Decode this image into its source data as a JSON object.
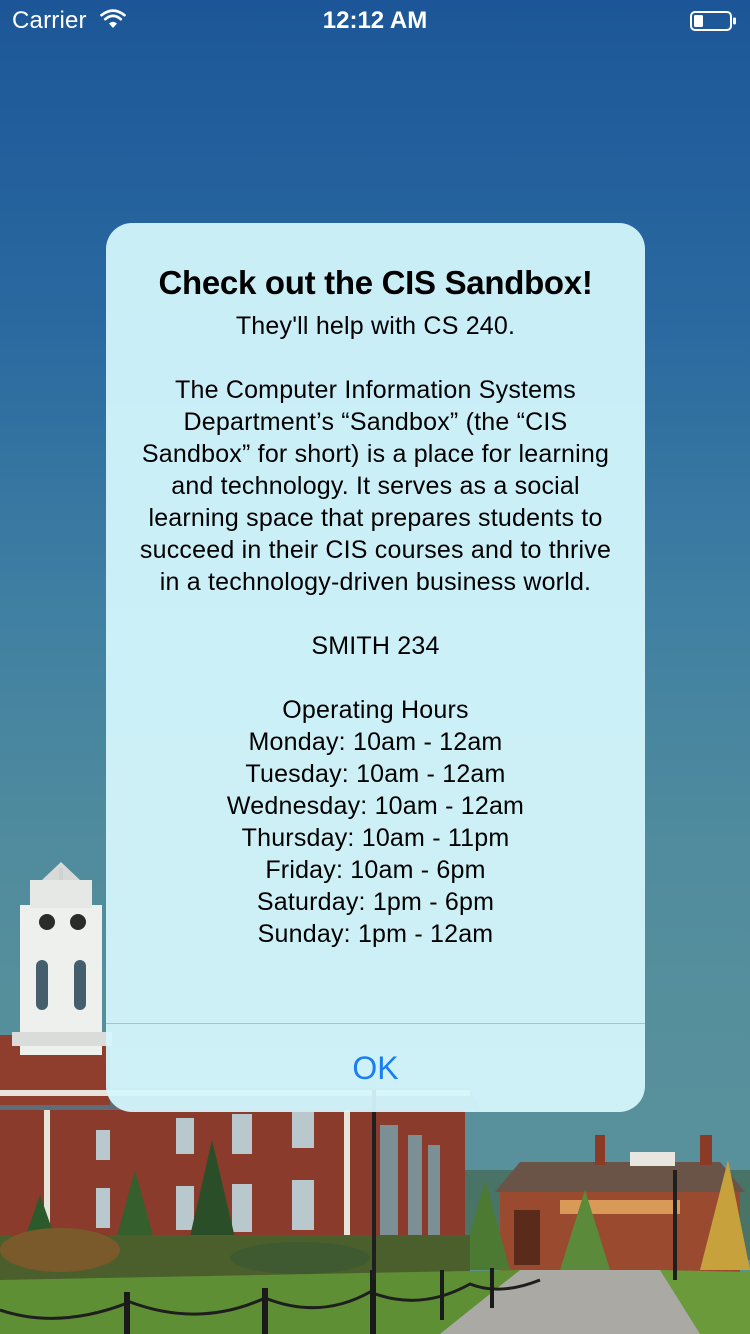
{
  "status_bar": {
    "carrier": "Carrier",
    "time": "12:12 AM",
    "wifi_icon": "wifi-icon",
    "battery_icon": "battery-icon",
    "battery_level": 0.25
  },
  "background": {
    "sky_color": "#1c5698",
    "scene": "campus-building-illustration"
  },
  "alert": {
    "title": "Check out the CIS Sandbox!",
    "message": "They'll help with CS 240.\n\nThe Computer Information Systems Department’s “Sandbox” (the “CIS Sandbox” for short) is a place for learning and technology. It serves as a social learning space that prepares students to succeed in their CIS courses and to thrive in a technology-driven business world.\n\nSMITH 234\n\nOperating Hours\nMonday: 10am - 12am\nTuesday: 10am - 12am\nWednesday: 10am - 12am\nThursday: 10am - 11pm\nFriday: 10am - 6pm\nSaturday: 1pm - 6pm\nSunday: 1pm - 12am",
    "ok_label": "OK",
    "accent_color": "#1a7ef2"
  }
}
